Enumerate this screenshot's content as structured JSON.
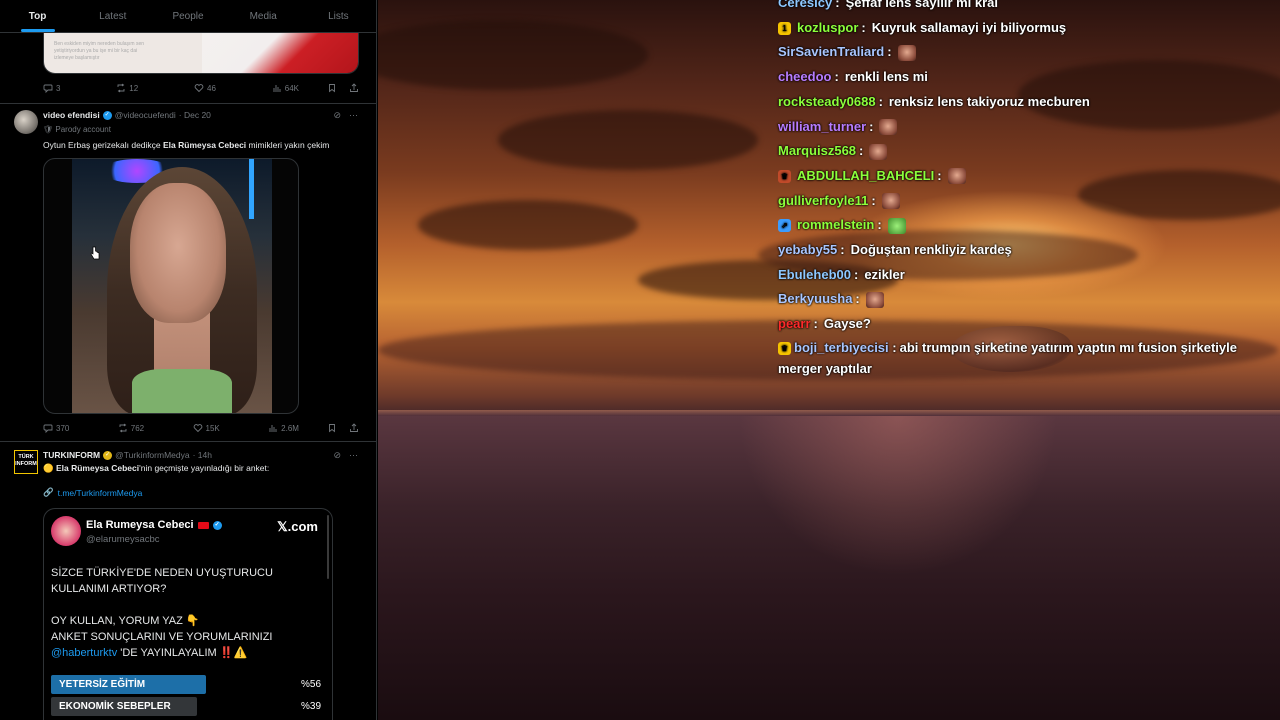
{
  "feed": {
    "tabs": [
      "Top",
      "Latest",
      "People",
      "Media",
      "Lists"
    ],
    "active_tab": "Top",
    "prev_tweet": {
      "media_caption_lines": [
        "Ben eskiden miyim nereden bulaşım sen",
        "yetiştiriyordun ya bu işe mi bir kaç dai",
        "izlemeye başlamıştır"
      ],
      "stats": {
        "replies": "3",
        "reposts": "12",
        "likes": "46",
        "views": "64K"
      }
    },
    "tweet1": {
      "name": "video efendisi",
      "handle": "@videocuefendi",
      "date": "· Dec 20",
      "label": "Parody account",
      "text_before": "Oytun Erbaş gerizekalı dedikçe ",
      "text_bold": "Ela Rümeysa Cebeci",
      "text_after": " mimikleri yakın çekim",
      "stats": {
        "replies": "370",
        "reposts": "762",
        "likes": "15K",
        "views": "2.6M"
      }
    },
    "tweet2": {
      "name": "TURKINFORM",
      "handle": "@TurkinformMedya",
      "date": "· 14h",
      "avatar_text": "TÜRK INFORM",
      "text_bold": "Ela Rümeysa Cebeci",
      "text_after": "'nin geçmişte yayınladığı bir anket:",
      "link": "t.me/TurkinformMedya",
      "card": {
        "name": "Ela Rumeysa Cebeci",
        "handle": "@elarumeysacbc",
        "brand": "𝕏.com",
        "line1": "SİZCE TÜRKİYE'DE NEDEN UYUŞTURUCU",
        "line2": "KULLANIMI ARTIYOR?",
        "line3": "OY KULLAN, YORUM YAZ 👇",
        "line4": "ANKET SONUÇLARINI VE YORUMLARINIZI",
        "mention": "@haberturktv",
        "line5_rest": " 'DE YAYINLAYALIM ",
        "line5_marks": "‼️⚠️",
        "poll": [
          {
            "label": "YETERSİZ EĞİTİM",
            "pct": "%56",
            "value": 56,
            "color": "#1d6fa8"
          },
          {
            "label": "EKONOMİK SEBEPLER",
            "pct": "%39",
            "value": 39,
            "color": "#333639"
          }
        ]
      }
    }
  },
  "chat": {
    "messages": [
      {
        "user": "Ceresicy",
        "color": "#8ec8ff",
        "text": "Şeffaf lens sayılır mı kral",
        "badge": null,
        "emote": null
      },
      {
        "user": "kozluspor",
        "color": "#8cff3b",
        "text": "Kuyruk sallamayi iyi biliyormuş",
        "badge": "1",
        "badge_color": "#f5c400",
        "emote": null
      },
      {
        "user": "SirSavienTraliard",
        "color": "#a9c6ff",
        "text": "",
        "badge": null,
        "emote": "face-emote"
      },
      {
        "user": "cheedoo",
        "color": "#b77cff",
        "text": "renkli lens mi",
        "badge": null,
        "emote": null
      },
      {
        "user": "rocksteady0688",
        "color": "#8cff3b",
        "text": "renksiz lens takiyoruz mecburen",
        "badge": null,
        "emote": null
      },
      {
        "user": "william_turner",
        "color": "#b77cff",
        "text": "",
        "badge": null,
        "emote": "face-emote"
      },
      {
        "user": "Marquisz568",
        "color": "#8cff3b",
        "text": "",
        "badge": null,
        "emote": "face-emote"
      },
      {
        "user": "ABDULLAH_BAHCELI",
        "color": "#8cff3b",
        "text": "",
        "badge": "♛",
        "badge_color": "#c04a2a",
        "emote": "face-emote"
      },
      {
        "user": "gulliverfoyle11",
        "color": "#8cff3b",
        "text": "",
        "badge": null,
        "emote": "face-emote"
      },
      {
        "user": "rommelstein",
        "color": "#8cff3b",
        "text": "",
        "badge": "⇗",
        "badge_color": "#3a9cff",
        "emote": "frog-emote"
      },
      {
        "user": "yebaby55",
        "color": "#a9c6ff",
        "text": "Doğuştan renkliyiz kardeş",
        "badge": null,
        "emote": null
      },
      {
        "user": "Ebuleheb00",
        "color": "#8ec8ff",
        "text": "ezikler",
        "badge": null,
        "emote": null
      },
      {
        "user": "Berkyuusha",
        "color": "#a9c6ff",
        "text": "",
        "badge": null,
        "emote": "face-emote"
      },
      {
        "user": "pearr",
        "color": "#ff2a2a",
        "text": "Gayse?",
        "badge": null,
        "emote": null
      },
      {
        "user": "boji_terbiyecisi",
        "color": "#a9c6ff",
        "text": "abi trumpın şirketine yatırım yaptın mı fusion şirketiyle merger yaptılar",
        "badge": "♛",
        "badge_color": "#f5c400",
        "emote": null
      }
    ]
  },
  "colors": {
    "accent": "#1d9bf0",
    "feed_bg": "#000000",
    "muted": "#71767b"
  }
}
